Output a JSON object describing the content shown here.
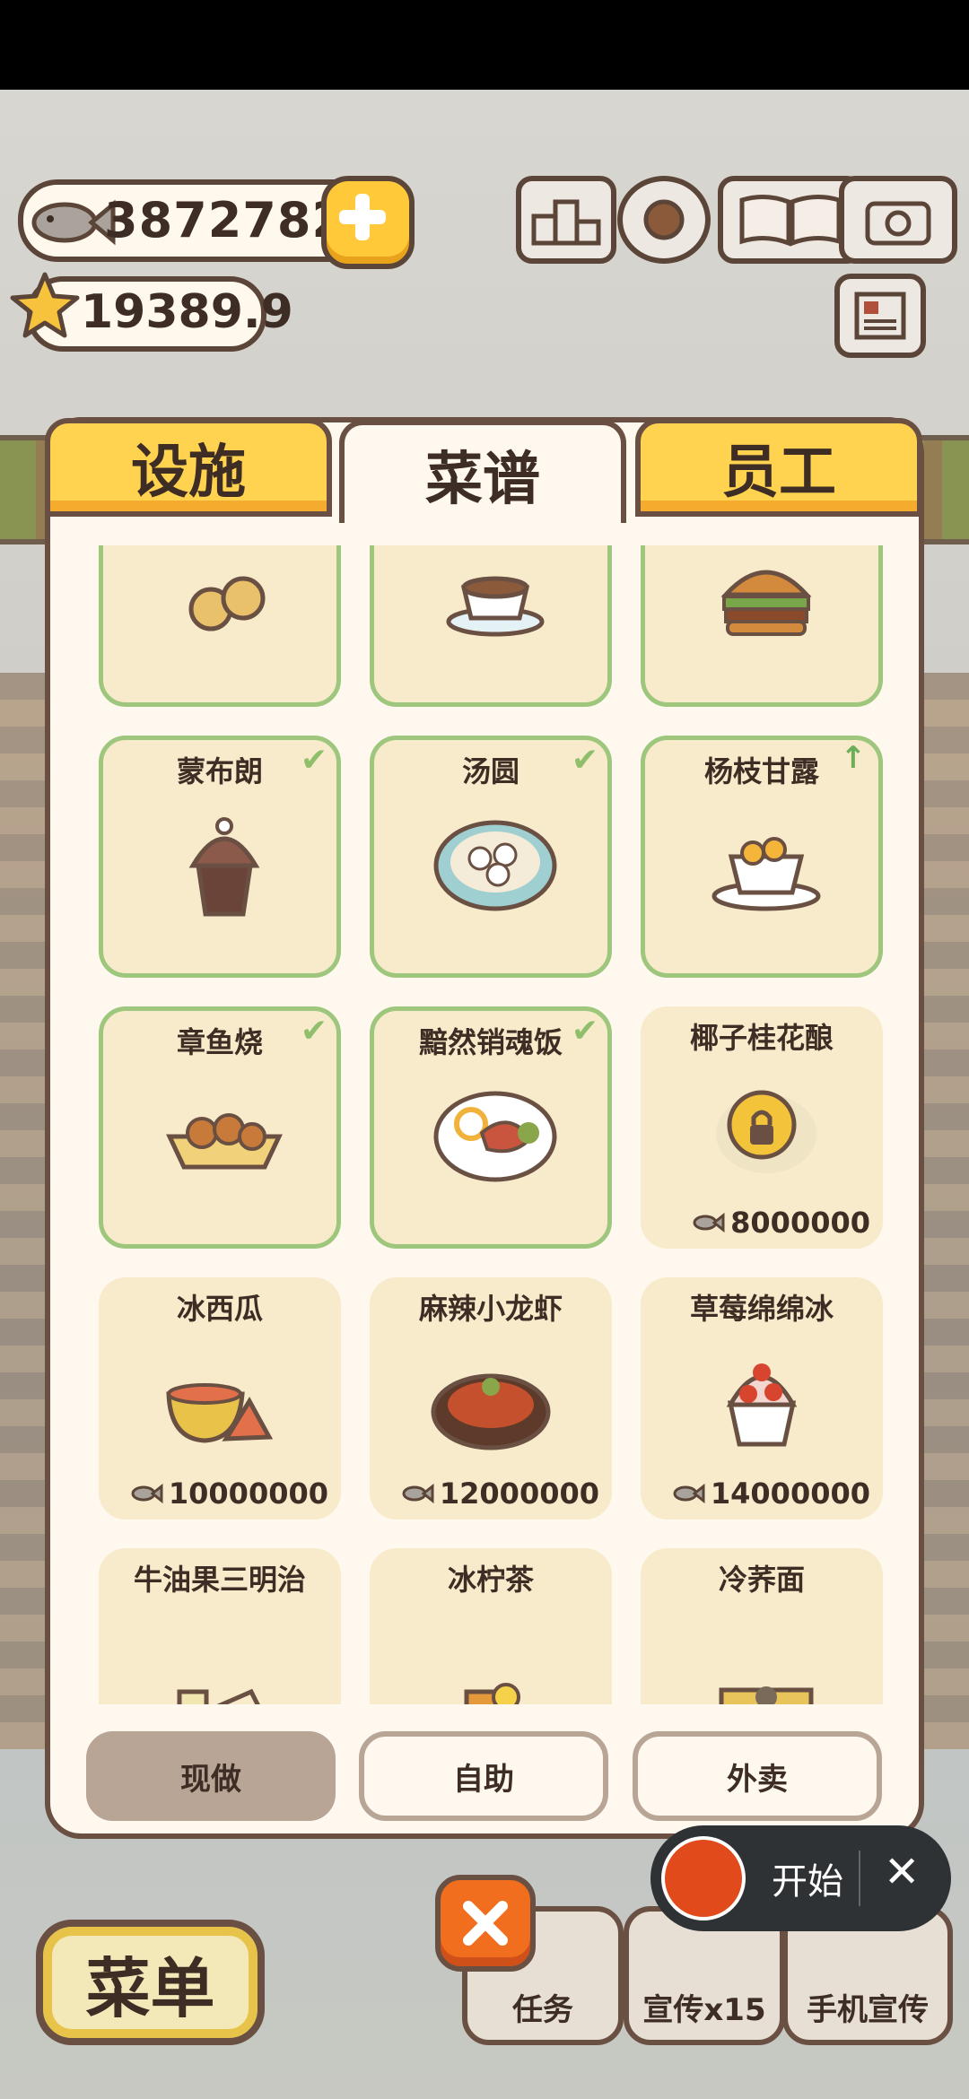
{
  "currency": {
    "fish": "3872782",
    "stars": "19389.9"
  },
  "top_icons": [
    "ranking-icon",
    "settings-gear-icon",
    "recipe-book-icon",
    "camera-icon",
    "newspaper-icon"
  ],
  "tabs": [
    {
      "label": "设施",
      "active": false
    },
    {
      "label": "菜谱",
      "active": true
    },
    {
      "label": "员工",
      "active": false
    }
  ],
  "recipes": [
    {
      "name": "",
      "owned": true,
      "badge": "",
      "price": "",
      "icon": "cookies-icon"
    },
    {
      "name": "",
      "owned": true,
      "badge": "",
      "price": "",
      "icon": "teacup-icon"
    },
    {
      "name": "",
      "owned": true,
      "badge": "",
      "price": "",
      "icon": "burger-icon"
    },
    {
      "name": "蒙布朗",
      "owned": true,
      "badge": "check",
      "price": "",
      "icon": "mont-blanc-icon"
    },
    {
      "name": "汤圆",
      "owned": true,
      "badge": "check",
      "price": "",
      "icon": "tangyuan-bowl-icon"
    },
    {
      "name": "杨枝甘露",
      "owned": true,
      "badge": "upgrade",
      "price": "",
      "icon": "mango-dessert-icon"
    },
    {
      "name": "章鱼烧",
      "owned": true,
      "badge": "check",
      "price": "",
      "icon": "takoyaki-icon"
    },
    {
      "name": "黯然销魂饭",
      "owned": true,
      "badge": "check",
      "price": "",
      "icon": "rice-plate-icon"
    },
    {
      "name": "椰子桂花酿",
      "owned": false,
      "badge": "lock",
      "price": "8000000",
      "icon": "lock-icon"
    },
    {
      "name": "冰西瓜",
      "owned": false,
      "badge": "",
      "price": "10000000",
      "icon": "watermelon-icon"
    },
    {
      "name": "麻辣小龙虾",
      "owned": false,
      "badge": "",
      "price": "12000000",
      "icon": "crayfish-pot-icon"
    },
    {
      "name": "草莓绵绵冰",
      "owned": false,
      "badge": "",
      "price": "14000000",
      "icon": "strawberry-ice-icon"
    },
    {
      "name": "牛油果三明治",
      "owned": false,
      "badge": "",
      "price": "",
      "icon": "sandwich-icon"
    },
    {
      "name": "冰柠茶",
      "owned": false,
      "badge": "",
      "price": "",
      "icon": "lemon-tea-icon"
    },
    {
      "name": "冷荞面",
      "owned": false,
      "badge": "",
      "price": "",
      "icon": "cold-noodle-icon"
    }
  ],
  "modes": [
    {
      "label": "现做",
      "active": true
    },
    {
      "label": "自助",
      "active": false
    },
    {
      "label": "外卖",
      "active": false
    }
  ],
  "bottom": {
    "menu": "菜单",
    "task": "任务",
    "promo": "宣传x15",
    "phone_promo": "手机宣传"
  },
  "recorder": {
    "start": "开始",
    "close": "✕"
  },
  "colors": {
    "owned_border": "#9ec67c",
    "card_bg": "#f8ebcb",
    "tab_yellow": "#ffd24f",
    "record_red": "#e14a1a"
  }
}
